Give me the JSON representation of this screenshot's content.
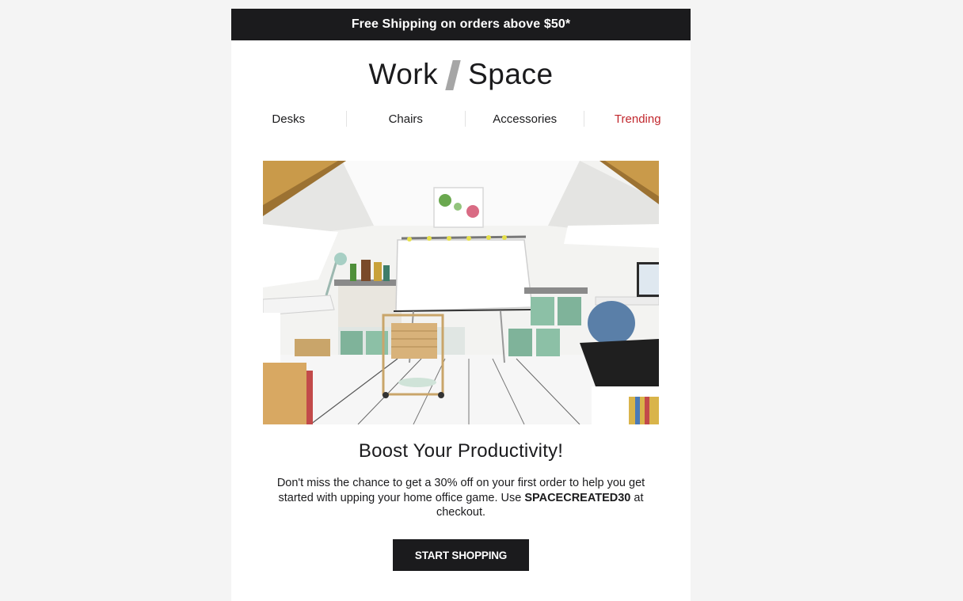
{
  "banner": {
    "text": "Free Shipping on orders above $50*"
  },
  "logo": {
    "left": "Work",
    "right": "Space"
  },
  "nav": {
    "desks": "Desks",
    "chairs": "Chairs",
    "accessories": "Accessories",
    "trending": "Trending"
  },
  "hero": {
    "alt": "Bright white attic home office with drafting table, desks, chair and storage shelves"
  },
  "headline": "Boost Your Productivity!",
  "body": {
    "before": "Don't miss the chance to get a 30% off on your first order to help you get started with upping your home office game. Use ",
    "code": "SPACECREATED30",
    "after": " at checkout."
  },
  "cta": {
    "label": "START SHOPPING"
  },
  "colors": {
    "dark": "#1b1b1d",
    "accent": "#c1272d",
    "page_bg": "#f4f4f4",
    "slash": "#a6a6a6"
  }
}
